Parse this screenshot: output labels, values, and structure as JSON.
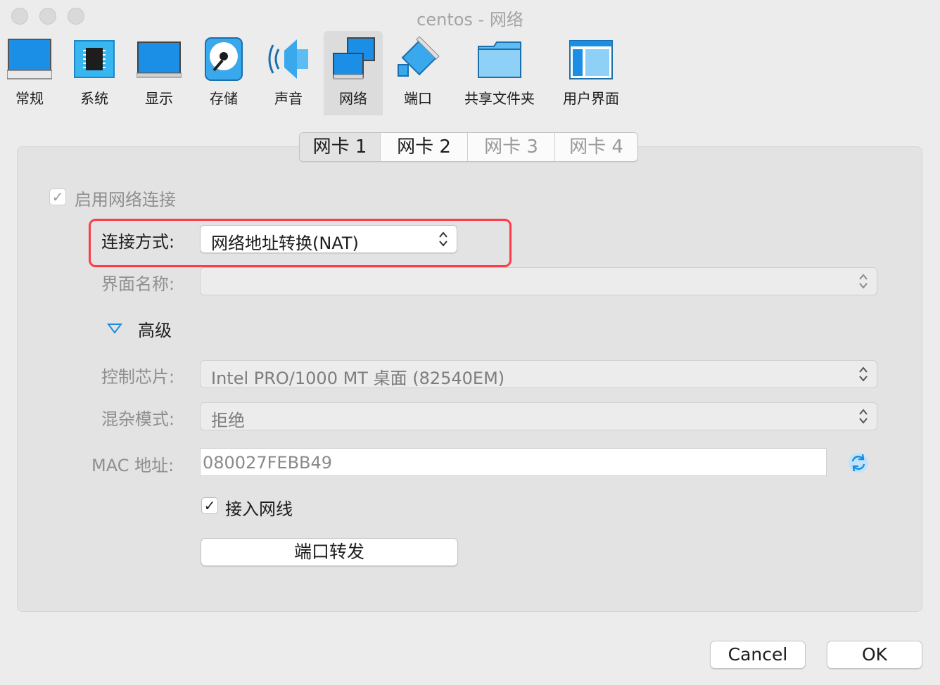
{
  "window": {
    "title": "centos - 网络"
  },
  "toolbar": {
    "items": [
      {
        "label": "常规",
        "icon": "general-monitor-icon"
      },
      {
        "label": "系统",
        "icon": "chip-icon"
      },
      {
        "label": "显示",
        "icon": "display-monitor-icon"
      },
      {
        "label": "存储",
        "icon": "disk-icon"
      },
      {
        "label": "声音",
        "icon": "speaker-icon"
      },
      {
        "label": "网络",
        "icon": "network-icon"
      },
      {
        "label": "端口",
        "icon": "serial-port-icon"
      },
      {
        "label": "共享文件夹",
        "icon": "folder-icon"
      },
      {
        "label": "用户界面",
        "icon": "ui-window-icon"
      }
    ],
    "selected": "网络"
  },
  "tabs": [
    {
      "label": "网卡 1",
      "state": "selected"
    },
    {
      "label": "网卡 2",
      "state": "enabled"
    },
    {
      "label": "网卡 3",
      "state": "disabled"
    },
    {
      "label": "网卡 4",
      "state": "disabled"
    }
  ],
  "adapter": {
    "enable_label": "启用网络连接",
    "enable_checked": true,
    "attach_label": "连接方式:",
    "attach_value": "网络地址转换(NAT)",
    "name_label": "界面名称:",
    "name_value": "",
    "advanced_label": "高级",
    "chip_label": "控制芯片:",
    "chip_value": "Intel PRO/1000 MT 桌面 (82540EM)",
    "promisc_label": "混杂模式:",
    "promisc_value": "拒绝",
    "mac_label": "MAC 地址:",
    "mac_value": "080027FEBB49",
    "cable_label": "接入网线",
    "cable_checked": true,
    "port_forward_label": "端口转发"
  },
  "footer": {
    "cancel_label": "Cancel",
    "ok_label": "OK"
  },
  "colors": {
    "highlight_border": "#ff3b4a",
    "accent_blue": "#1a8de0"
  }
}
